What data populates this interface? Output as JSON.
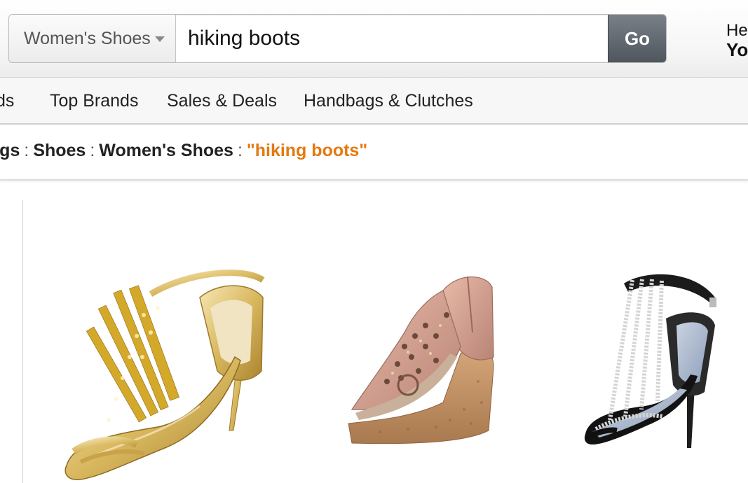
{
  "search": {
    "department": "Women's Shoes",
    "query": "hiking boots",
    "go_label": "Go"
  },
  "account": {
    "greeting": "He",
    "name": "Yo"
  },
  "nav": {
    "items": [
      "ds",
      "Top Brands",
      "Sales & Deals",
      "Handbags & Clutches"
    ]
  },
  "breadcrumb": {
    "items": [
      "bags",
      "Shoes",
      "Women's Shoes"
    ],
    "separator": ":",
    "current": "\"hiking boots\""
  },
  "products": [
    {
      "image": "gold-rhinestone-t-strap-heel"
    },
    {
      "image": "pink-jeweled-cork-wedge"
    },
    {
      "image": "black-rhinestone-strappy-heel"
    }
  ],
  "colors": {
    "accent": "#e47911",
    "go_button": "#5f656d"
  }
}
